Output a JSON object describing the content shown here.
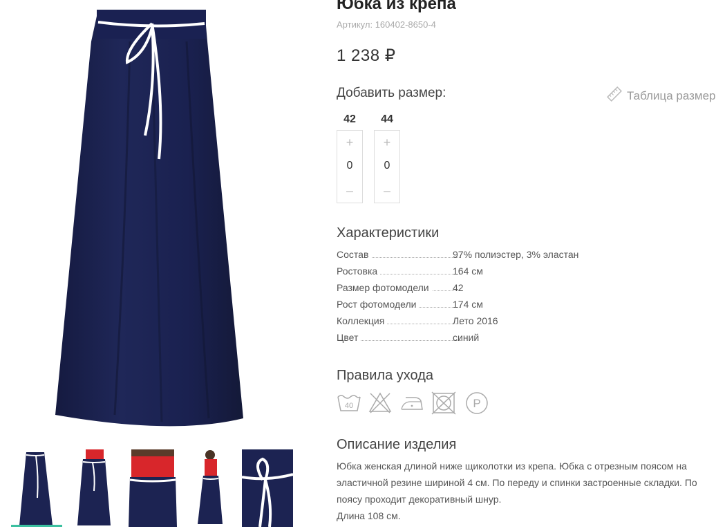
{
  "product": {
    "title": "Юбка из крепа",
    "sku": "Артикул: 160402-8650-4",
    "price": "1 238 ₽"
  },
  "sizes": {
    "add_label": "Добавить размер:",
    "table_label": "Таблица размеров",
    "items": [
      {
        "size": "42",
        "plus": "+",
        "qty": "0",
        "minus": "–"
      },
      {
        "size": "44",
        "plus": "+",
        "qty": "0",
        "minus": "–"
      }
    ]
  },
  "characteristics": {
    "heading": "Характеристики",
    "rows": [
      {
        "key": "Состав",
        "value": "97% полиэстер, 3% эластан"
      },
      {
        "key": "Ростовка",
        "value": "164 см"
      },
      {
        "key": "Размер фотомодели",
        "value": "42"
      },
      {
        "key": "Рост фотомодели",
        "value": "174 см"
      },
      {
        "key": "Коллекция",
        "value": "Лето 2016"
      },
      {
        "key": "Цвет",
        "value": "синий"
      }
    ]
  },
  "care": {
    "heading": "Правила ухода",
    "icons": [
      "wash-40-icon",
      "no-bleach-icon",
      "iron-low-icon",
      "no-tumble-dry-icon",
      "dry-clean-p-icon"
    ],
    "wash_temp": "40",
    "dry_clean_letter": "P"
  },
  "description": {
    "heading": "Описание изделия",
    "text": "Юбка женская длиной ниже щиколотки из крепа. Юбка с отрезным поясом на эластичной резине шириной 4 см. По переду и спинки застроенные складки. По поясу проходит декоративный шнур.",
    "length": "Длина 108 см."
  },
  "colors": {
    "skirt": "#1c2352",
    "accent": "#3cc0a0",
    "top": "#d8262b"
  }
}
